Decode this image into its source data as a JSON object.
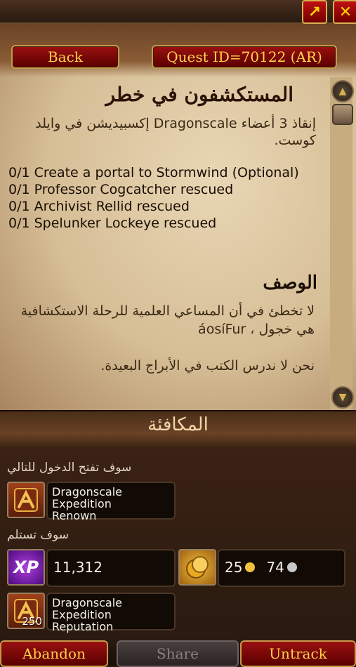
{
  "window": {
    "corner_buttons": [
      {
        "icon": "arrow-diagonal-icon",
        "glyph": "↗"
      },
      {
        "icon": "close-icon",
        "glyph": "✕"
      }
    ]
  },
  "header": {
    "back_label": "Back",
    "quest_id_label": "Quest ID=70122 (AR)"
  },
  "quest": {
    "title": "المستكشفون في خطر",
    "summary": "إنقاذ 3 أعضاء Dragonscale إكسبيديشن في وايلد كوست.",
    "objectives": [
      "0/1 Create a portal to Stormwind (Optional)",
      "0/1 Professor Cogcatcher rescued",
      "0/1 Archivist Rellid rescued",
      "0/1 Spelunker Lockeye rescued"
    ],
    "description_heading": "الوصف",
    "description_paragraphs": [
      "لا تخطئ في أن المساعي العلمية للرحلة الاستكشافية هي خجول ، áosíFur",
      "نحن لا ندرس الكتب في الأبراج البعيدة."
    ]
  },
  "scrollbar": {
    "up_icon": "scroll-up-icon",
    "down_icon": "scroll-down-icon"
  },
  "rewards": {
    "title": "المكافئة",
    "unlock_label": "سوف تفتح الدخول للتالي",
    "renown": {
      "icon": "dragonscale-emblem-icon",
      "text": "Dragonscale Expedition Renown"
    },
    "receive_label": "سوف تستلم",
    "xp": {
      "icon": "xp-icon",
      "icon_text": "XP",
      "value": "11,312"
    },
    "money": {
      "icon": "gold-coins-icon",
      "gold": "25",
      "silver": "74"
    },
    "reputation": {
      "icon": "dragonscale-emblem-icon",
      "amount": "250",
      "text": "Dragonscale Expedition Reputation"
    }
  },
  "footer": {
    "abandon_label": "Abandon",
    "share_label": "Share",
    "untrack_label": "Untrack"
  },
  "colors": {
    "button_red": "#9a1010",
    "button_text": "#ffd24a",
    "parchment": "#e0cca8"
  }
}
